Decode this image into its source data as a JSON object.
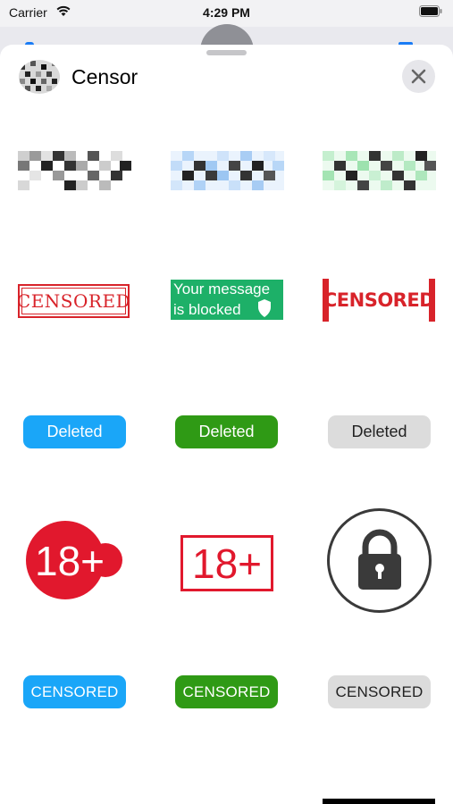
{
  "status_bar": {
    "carrier": "Carrier",
    "time": "4:29 PM"
  },
  "sheet": {
    "title": "Censor",
    "close_icon": "close-icon"
  },
  "stickers": {
    "row1": [
      "pixel-mosaic-gray",
      "pixel-mosaic-blue",
      "pixel-mosaic-green"
    ],
    "row2": {
      "censored_stamp": "CENSORED",
      "blocked_line1": "Your  message",
      "blocked_line2": "is blocked",
      "censored_bold": "CENSORED"
    },
    "row3": {
      "blue": "Deleted",
      "green": "Deleted",
      "gray": "Deleted"
    },
    "row4": {
      "circle_18": "18+",
      "box_18": "18+",
      "lock": "padlock-icon"
    },
    "row5": {
      "blue": "CENSORED",
      "green": "CENSORED",
      "gray": "CENSORED"
    }
  },
  "colors": {
    "blue": "#1aa6f8",
    "green": "#2f9a15",
    "gray": "#dcdcdc",
    "red": "#d8232a"
  }
}
